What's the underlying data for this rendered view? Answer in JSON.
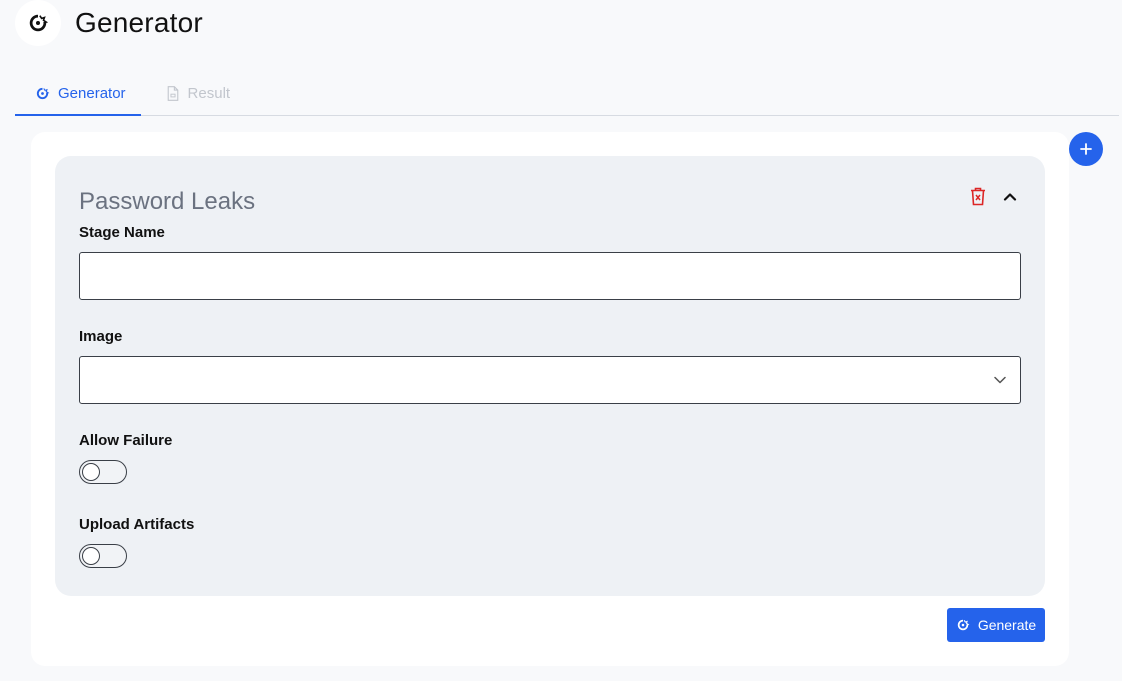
{
  "app": {
    "title": "Generator"
  },
  "tabs": [
    {
      "label": "Generator",
      "icon": "generator-icon",
      "active": true
    },
    {
      "label": "Result",
      "icon": "document-icon",
      "active": false
    }
  ],
  "stage": {
    "title": "Password Leaks",
    "fields": {
      "stage_name": {
        "label": "Stage Name",
        "value": "",
        "placeholder": ""
      },
      "image": {
        "label": "Image",
        "value": ""
      },
      "allow_failure": {
        "label": "Allow Failure",
        "enabled": false
      },
      "upload_artifacts": {
        "label": "Upload Artifacts",
        "enabled": false
      }
    }
  },
  "actions": {
    "generate_label": "Generate"
  },
  "colors": {
    "accent": "#2563eb",
    "danger": "#dc2626",
    "stage_bg": "#eef1f5"
  }
}
